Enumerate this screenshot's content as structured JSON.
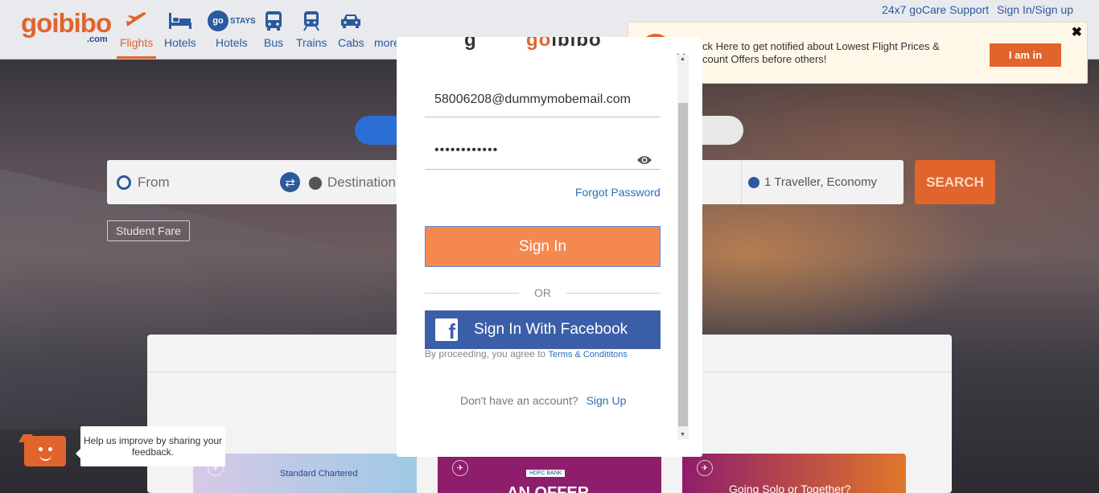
{
  "header": {
    "logo_main": "goibibo",
    "logo_sub": ".com",
    "nav": [
      {
        "label": "Flights",
        "icon": "plane-icon",
        "active": true
      },
      {
        "label": "Hotels",
        "icon": "bed-icon"
      },
      {
        "label": "Hotels",
        "icon": "gostays-icon",
        "badge_go": "go",
        "badge_stays": "STAYS"
      },
      {
        "label": "Bus",
        "icon": "bus-icon"
      },
      {
        "label": "Trains",
        "icon": "train-icon"
      },
      {
        "label": "Cabs",
        "icon": "car-icon"
      },
      {
        "label": "more",
        "icon": ""
      }
    ],
    "support_link": "24x7 goCare Support",
    "signin_link": "Sign In/Sign up"
  },
  "notify_banner": {
    "text": "ck Here to get notified about Lowest Flight Prices & count Offers before others!",
    "button_label": "I am in",
    "close_glyph": "✖"
  },
  "search": {
    "from_placeholder": "From",
    "destination_placeholder": "Destination",
    "travellers": "1 Traveller, Economy",
    "search_label": "SEARCH",
    "student_fare": "Student Fare"
  },
  "offers": [
    {
      "bank": "Standard Chartered"
    },
    {
      "bank": "HDFC BANK",
      "headline": "AN OFFER"
    },
    {
      "headline": "Going Solo or Together?"
    }
  ],
  "feedback": {
    "text": "Help us improve by sharing your feedback."
  },
  "modal": {
    "email_value": "58006208@dummymobemail.com",
    "password_value": "••••••••••••",
    "forgot_label": "Forgot Password",
    "signin_label": "Sign In",
    "or_label": "OR",
    "facebook_label": "Sign In With Facebook",
    "terms_prefix": "By proceeding, you agree to",
    "terms_link": "Terms & Condititons",
    "no_account": "Don't have an account?",
    "signup_label": "Sign Up",
    "close_glyph": "✕"
  },
  "colors": {
    "brand_orange": "#e1642c",
    "brand_blue": "#2a5a9e",
    "facebook_blue": "#3b5ea8",
    "signin_orange": "#f4884f"
  }
}
